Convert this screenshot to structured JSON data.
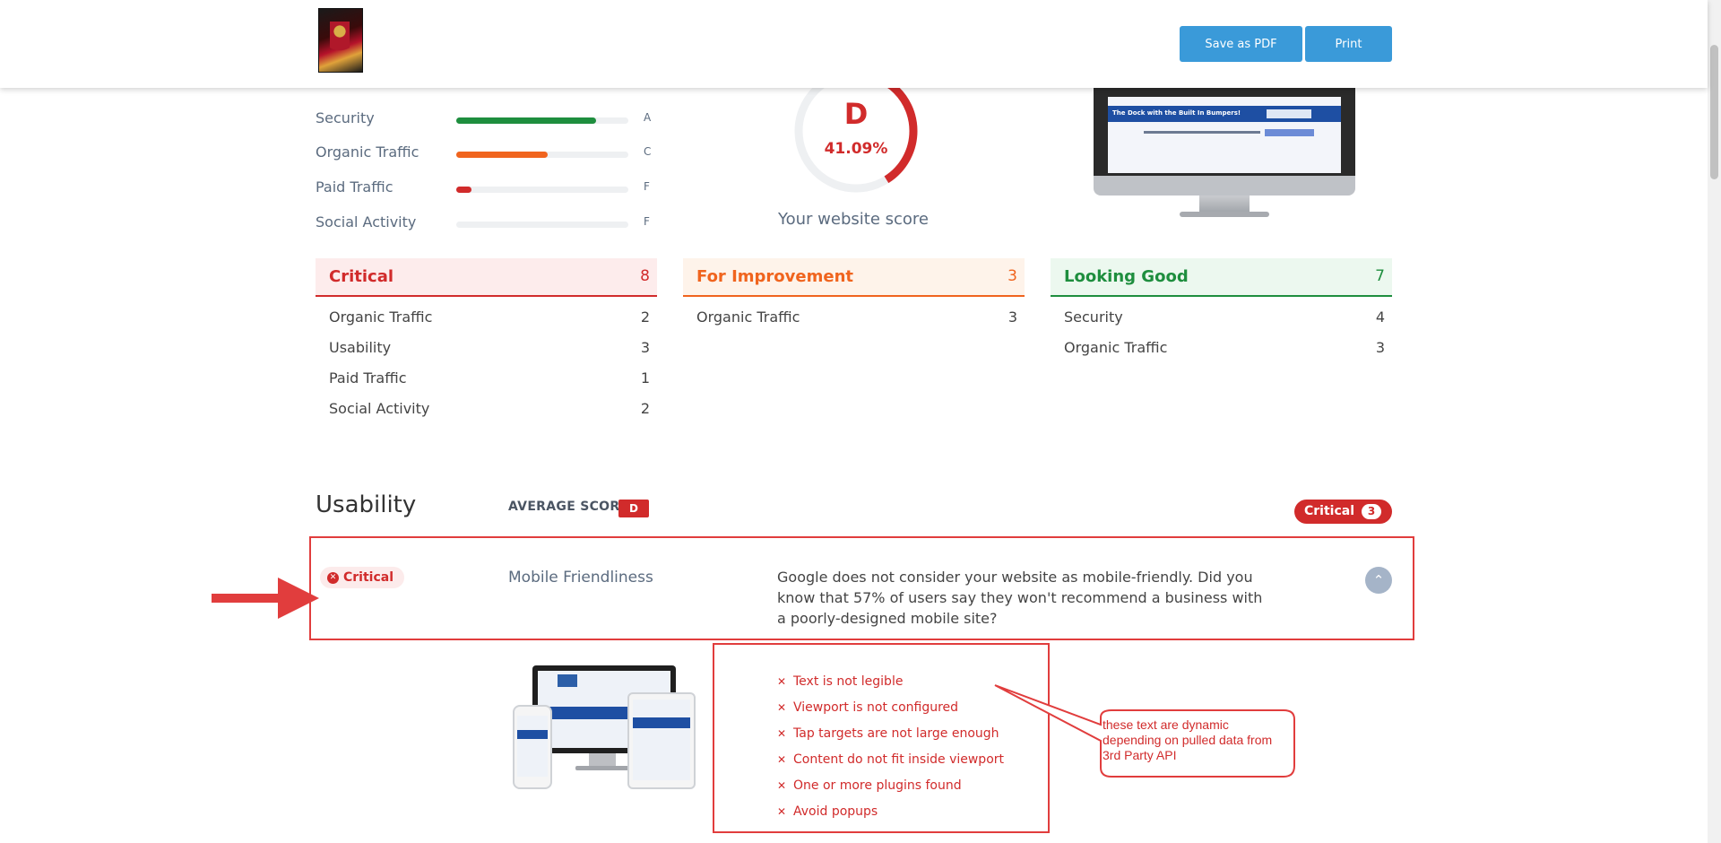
{
  "header": {
    "logo_alt": "site logo",
    "save_pdf_label": "Save as PDF",
    "print_label": "Print"
  },
  "categories": [
    {
      "label": "Security",
      "grade": "A",
      "score": 0.81,
      "color": "#1e8e3e"
    },
    {
      "label": "Organic Traffic",
      "grade": "C",
      "score": 0.53,
      "color": "#f0641e"
    },
    {
      "label": "Paid Traffic",
      "grade": "F",
      "score": 0.09,
      "color": "#d12b2b"
    },
    {
      "label": "Social Activity",
      "grade": "F",
      "score": 0.0,
      "color": "#d12b2b"
    }
  ],
  "website_score": {
    "grade": "D",
    "percent": "41.09%",
    "value": 0.4109,
    "caption": "Your website score",
    "color": "#d12b2b"
  },
  "summary": {
    "critical": {
      "title": "Critical",
      "count": "8",
      "color": "#d12b2b",
      "bg": "#fdecec",
      "items": [
        {
          "label": "Organic Traffic",
          "count": "2"
        },
        {
          "label": "Usability",
          "count": "3"
        },
        {
          "label": "Paid Traffic",
          "count": "1"
        },
        {
          "label": "Social Activity",
          "count": "2"
        }
      ]
    },
    "improvement": {
      "title": "For Improvement",
      "count": "3",
      "color": "#f0641e",
      "bg": "#fef3ea",
      "items": [
        {
          "label": "Organic Traffic",
          "count": "3"
        }
      ]
    },
    "good": {
      "title": "Looking Good",
      "count": "7",
      "color": "#1e8e3e",
      "bg": "#ecf8ef",
      "items": [
        {
          "label": "Security",
          "count": "4"
        },
        {
          "label": "Organic Traffic",
          "count": "3"
        }
      ]
    }
  },
  "usability": {
    "title": "Usability",
    "avg_label": "AVERAGE SCORE:",
    "avg_grade": "D",
    "critical_pill_label": "Critical",
    "critical_pill_count": "3",
    "item": {
      "status": "Critical",
      "title": "Mobile Friendliness",
      "description": "Google does not consider your website as mobile-friendly. Did you know that 57% of users say they won't recommend a business with a poorly-designed mobile site?"
    },
    "issues": [
      "Text is not legible",
      "Viewport is not configured",
      "Tap targets are not large enough",
      "Content do not fit inside viewport",
      "One or more plugins found",
      "Avoid popups"
    ]
  },
  "preview": {
    "banner_text": "The Dock with the Built In Bumpers!"
  },
  "annotation": {
    "callout_text": "these text are dynamic depending on pulled data from 3rd Party API",
    "color": "#e13d3d"
  }
}
